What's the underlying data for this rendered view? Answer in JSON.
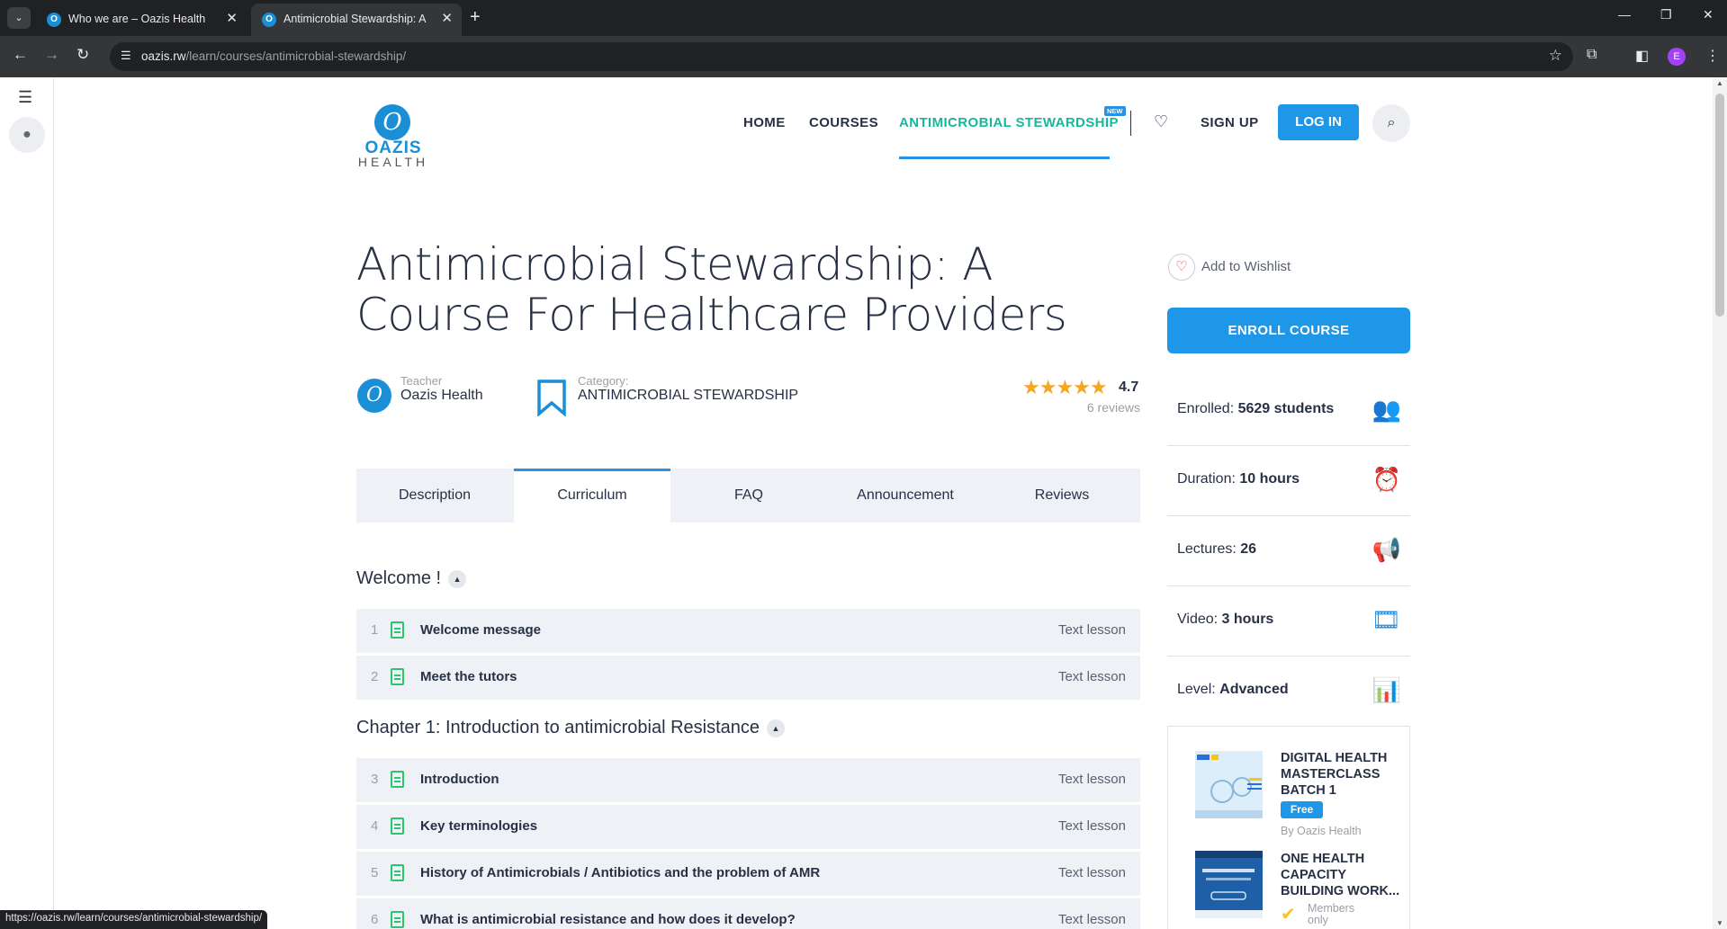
{
  "browser": {
    "tabs": [
      {
        "title": "Who we are – Oazis Health",
        "active": false
      },
      {
        "title": "Antimicrobial Stewardship: A Co",
        "active": true
      }
    ],
    "url_domain": "oazis.rw",
    "url_path": "/learn/courses/antimicrobial-stewardship/",
    "profile_initial": "E",
    "status_url": "https://oazis.rw/learn/courses/antimicrobial-stewardship/"
  },
  "header": {
    "logo_name": "OAZIS",
    "logo_sub": "HEALTH",
    "nav": {
      "home": "HOME",
      "courses": "COURSES",
      "stewardship": "ANTIMICROBIAL STEWARDSHIP",
      "new_badge": "NEW",
      "signup": "SIGN UP",
      "login": "LOG IN"
    }
  },
  "course": {
    "title": "Antimicrobial Stewardship: A Course For Healthcare Providers",
    "teacher_label": "Teacher",
    "teacher": "Oazis Health",
    "category_label": "Category:",
    "category": "ANTIMICROBIAL STEWARDSHIP",
    "rating": "4.7",
    "reviews": "6 reviews",
    "stars": "★★★★★"
  },
  "tabs": {
    "description": "Description",
    "curriculum": "Curriculum",
    "faq": "FAQ",
    "announcement": "Announcement",
    "reviews": "Reviews"
  },
  "curriculum": {
    "section1": "Welcome !",
    "section2": "Chapter 1: Introduction to antimicrobial Resistance",
    "lessons": [
      {
        "num": "1",
        "title": "Welcome message",
        "type": "Text lesson"
      },
      {
        "num": "2",
        "title": "Meet the tutors",
        "type": "Text lesson"
      },
      {
        "num": "3",
        "title": "Introduction",
        "type": "Text lesson"
      },
      {
        "num": "4",
        "title": "Key terminologies",
        "type": "Text lesson"
      },
      {
        "num": "5",
        "title": "History of Antimicrobials / Antibiotics and the problem of AMR",
        "type": "Text lesson"
      },
      {
        "num": "6",
        "title": "What is antimicrobial resistance and how does it develop?",
        "type": "Text lesson"
      }
    ]
  },
  "sidebar": {
    "wishlist": "Add to Wishlist",
    "enroll": "ENROLL COURSE",
    "info": [
      {
        "label": "Enrolled:",
        "value": "5629 students",
        "icon": "users-icon"
      },
      {
        "label": "Duration:",
        "value": "10 hours",
        "icon": "alarm-clock-icon"
      },
      {
        "label": "Lectures:",
        "value": "26",
        "icon": "megaphone-icon"
      },
      {
        "label": "Video:",
        "value": "3 hours",
        "icon": "film-icon"
      },
      {
        "label": "Level:",
        "value": "Advanced",
        "icon": "bar-chart-icon"
      }
    ],
    "related": [
      {
        "title": "DIGITAL HEALTH MASTERCLASS BATCH 1",
        "badge": "Free",
        "by": "By Oazis Health"
      },
      {
        "title": "ONE HEALTH CAPACITY BUILDING WORK...",
        "members": "Members only"
      }
    ]
  },
  "colors": {
    "accent": "#1e97e9",
    "active_nav": "#18b79b",
    "star": "#f5a623",
    "lesson_icon": "#2ec46f"
  }
}
